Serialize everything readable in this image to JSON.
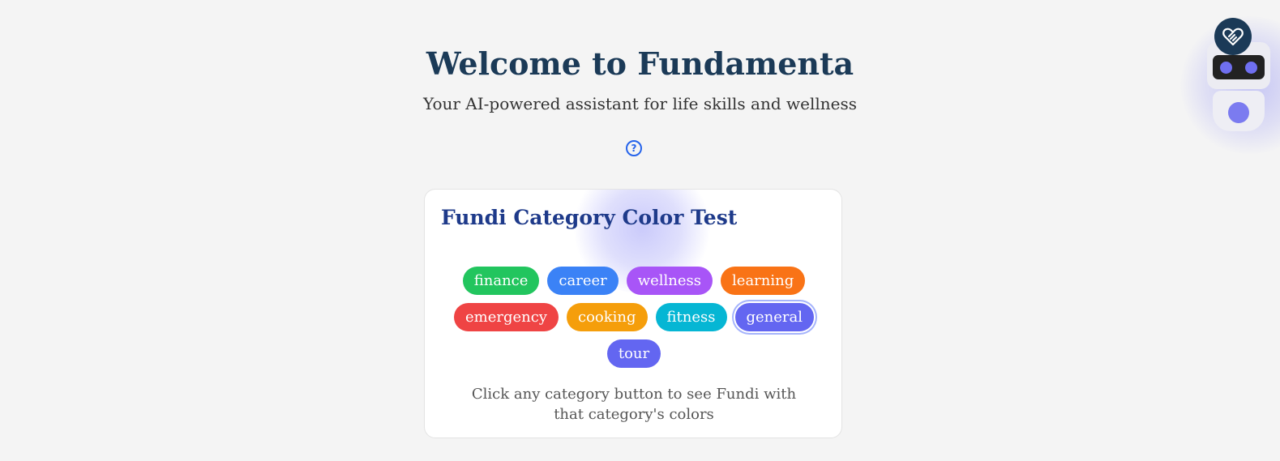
{
  "header": {
    "title": "Welcome to Fundamenta",
    "subtitle": "Your AI-powered assistant for life skills and wellness",
    "help_icon": "question-circle-icon",
    "help_symbol": "?"
  },
  "card": {
    "title": "Fundi Category Color Test",
    "note": "Click any category button to see Fundi with that category's colors",
    "categories": [
      {
        "label": "finance",
        "color": "#22c55e"
      },
      {
        "label": "career",
        "color": "#3b82f6"
      },
      {
        "label": "wellness",
        "color": "#a855f7"
      },
      {
        "label": "learning",
        "color": "#f97316"
      },
      {
        "label": "emergency",
        "color": "#ef4444"
      },
      {
        "label": "cooking",
        "color": "#f59e0b"
      },
      {
        "label": "fitness",
        "color": "#06b6d4"
      },
      {
        "label": "general",
        "color": "#6366f1",
        "selected": true
      },
      {
        "label": "tour",
        "color": "#6366f1"
      }
    ]
  },
  "assistant": {
    "name": "Fundi",
    "badge_icon": "heart-hands-icon",
    "eye_color": "#6f6ff0",
    "glow_color": "#8c8cf5"
  },
  "colors": {
    "background": "#f4f4f4",
    "title": "#1b3a57",
    "card_title": "#1e3a8a",
    "accent": "#2563eb"
  }
}
